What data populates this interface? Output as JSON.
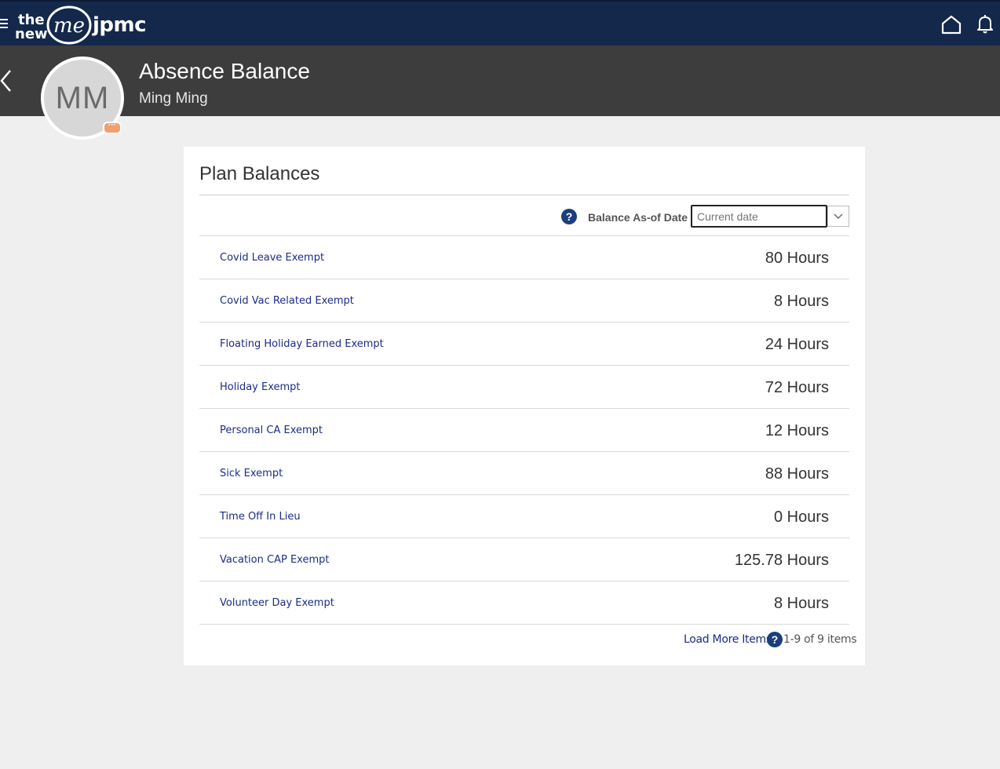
{
  "nav": {
    "logo_the": "the",
    "logo_new": "new",
    "logo_me": "me",
    "logo_jpmc": "jpmc"
  },
  "header": {
    "title": "Absence Balance",
    "subtitle": "Ming Ming",
    "avatar_initials": "MM",
    "avatar_badge": "···"
  },
  "card": {
    "title": "Plan Balances",
    "as_of_label": "Balance As-of Date",
    "date_placeholder": "Current date",
    "help_glyph": "?"
  },
  "balances": [
    {
      "name": "Covid Leave Exempt",
      "value": "80 Hours"
    },
    {
      "name": "Covid Vac Related Exempt",
      "value": "8 Hours"
    },
    {
      "name": "Floating Holiday Earned Exempt",
      "value": "24 Hours"
    },
    {
      "name": "Holiday Exempt",
      "value": "72 Hours"
    },
    {
      "name": "Personal CA Exempt",
      "value": "12 Hours"
    },
    {
      "name": "Sick Exempt",
      "value": "88 Hours"
    },
    {
      "name": "Time Off In Lieu",
      "value": "0 Hours"
    },
    {
      "name": "Vacation CAP Exempt",
      "value": "125.78 Hours"
    },
    {
      "name": "Volunteer Day Exempt",
      "value": "8 Hours"
    }
  ],
  "footer": {
    "load_more": "Load More Items",
    "count": "1-9 of 9 items"
  },
  "colors": {
    "nav_bg": "#14284b",
    "header_bg": "#3d3d3d",
    "link": "#1c2c8a",
    "help_badge": "#1c3f7c"
  }
}
